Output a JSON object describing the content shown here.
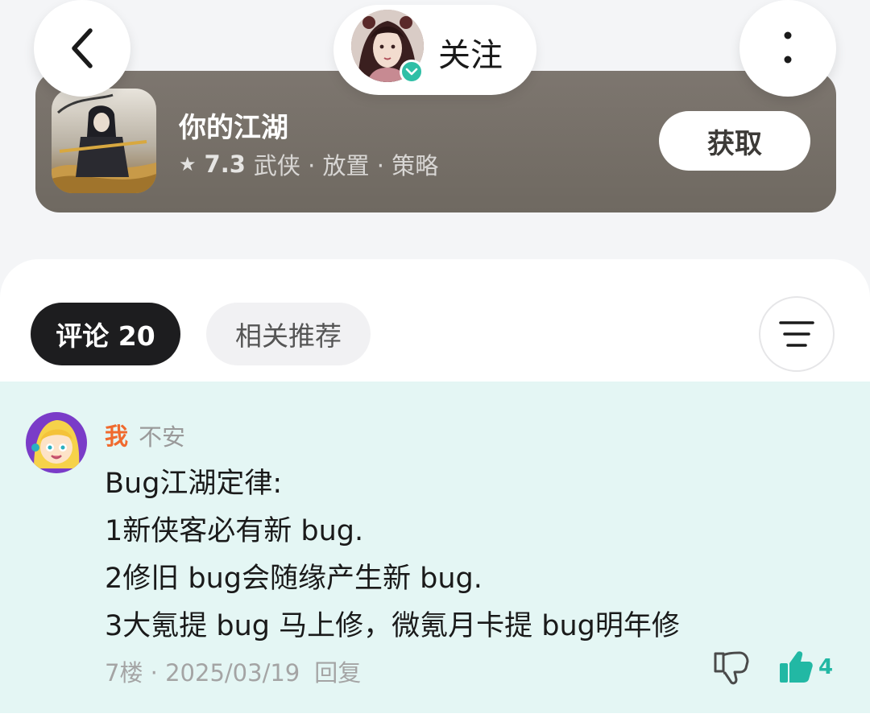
{
  "header": {
    "follow_label": "关注",
    "icons": {
      "back": "chevron-left-icon",
      "more": "more-vertical-icon",
      "verified": "verified-check-icon"
    }
  },
  "game": {
    "title": "你的江湖",
    "rating": "7.3",
    "rating_icon": "star-icon",
    "tags": "武侠 · 放置 · 策略",
    "get_label": "获取"
  },
  "tabs": {
    "comments_label": "评论 20",
    "related_label": "相关推荐",
    "sort_icon": "sort-lines-icon"
  },
  "comment": {
    "author": "我",
    "author_tag": "不安",
    "lines": [
      "Bug江湖定律:",
      "1新侠客必有新 bug.",
      "2修旧 bug会随缘产生新 bug.",
      "3大氪提 bug 马上修，微氪月卡提 bug明年修"
    ],
    "floor": "7楼",
    "date": "2025/03/19",
    "reply_label": "回复",
    "like_count": "4",
    "colors": {
      "author": "#f06a2e",
      "accent": "#22b8a4",
      "bg": "#e4f6f4"
    }
  }
}
